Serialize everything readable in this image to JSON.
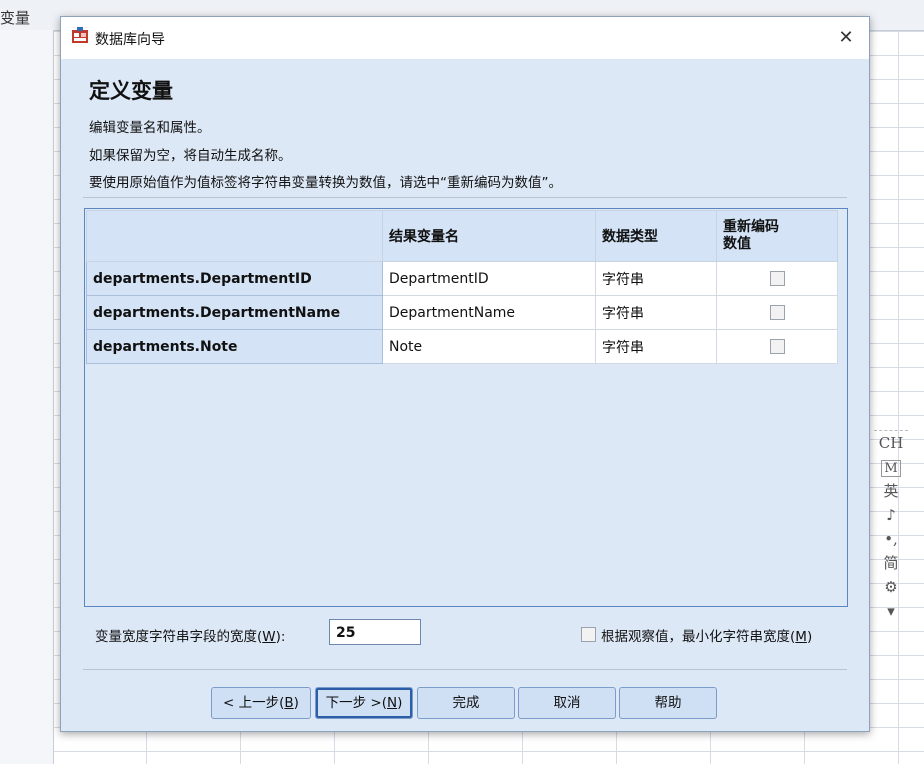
{
  "background": {
    "column_header_partial": "变量",
    "ime_toolbar": [
      "CH",
      "M",
      "英",
      "♪",
      "•,",
      "简",
      "⚙",
      "▾"
    ]
  },
  "dialog": {
    "title": "数据库向导",
    "heading": "定义变量",
    "descriptions": [
      "编辑变量名和属性。",
      "如果保留为空，将自动生成名称。",
      "要使用原始值作为值标签将字符串变量转换为数值，请选中“重新编码为数值”。"
    ],
    "table": {
      "headers": [
        "",
        "结果变量名",
        "数据类型",
        "重新编码\n数值"
      ],
      "header_recode_line1": "重新编码",
      "header_recode_line2": "数值",
      "rows": [
        {
          "source": "departments.DepartmentID",
          "result": "DepartmentID",
          "type": "字符串",
          "recode": false
        },
        {
          "source": "departments.DepartmentName",
          "result": "DepartmentName",
          "type": "字符串",
          "recode": false
        },
        {
          "source": "departments.Note",
          "result": "Note",
          "type": "字符串",
          "recode": false
        }
      ]
    },
    "width_label_prefix": "变量宽度字符串字段的宽度(",
    "width_label_key": "W",
    "width_label_suffix": "):",
    "width_value": "25",
    "minimize_label_prefix": "根据观察值，最小化字符串宽度(",
    "minimize_label_key": "M",
    "minimize_label_suffix": ")",
    "minimize_checked": false,
    "buttons": {
      "back_prefix": "< 上一步(",
      "back_key": "B",
      "back_suffix": ")",
      "next_prefix": "下一步 >(",
      "next_key": "N",
      "next_suffix": ")",
      "finish": "完成",
      "cancel": "取消",
      "help": "帮助"
    },
    "colors": {
      "dialog_bg": "#dde8f6",
      "header_bg": "#d4e3f6",
      "table_border": "#5b86c0",
      "button_bg": "#cfe0f5"
    }
  }
}
